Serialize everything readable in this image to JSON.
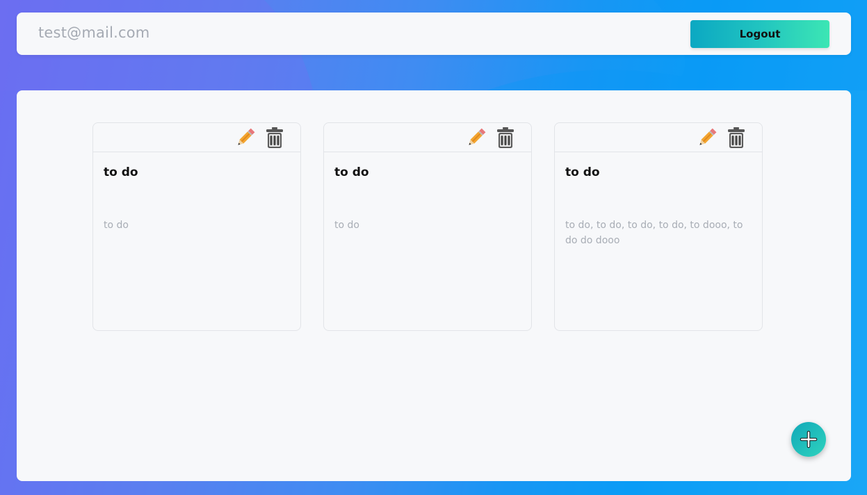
{
  "header": {
    "user_email": "test@mail.com",
    "logout_label": "Logout"
  },
  "notes": [
    {
      "title": "to do",
      "body": "to do"
    },
    {
      "title": "to do",
      "body": "to do"
    },
    {
      "title": "to do",
      "body": "to do, to do, to do, to do, to dooo, to do do dooo"
    }
  ],
  "icons": {
    "edit": "pencil-icon",
    "delete": "trash-icon",
    "add": "plus-icon"
  },
  "colors": {
    "accent_start": "#0ba8c2",
    "accent_end": "#3ce6b4",
    "panel": "#f7f8fa",
    "muted_text": "#a8adb5"
  }
}
